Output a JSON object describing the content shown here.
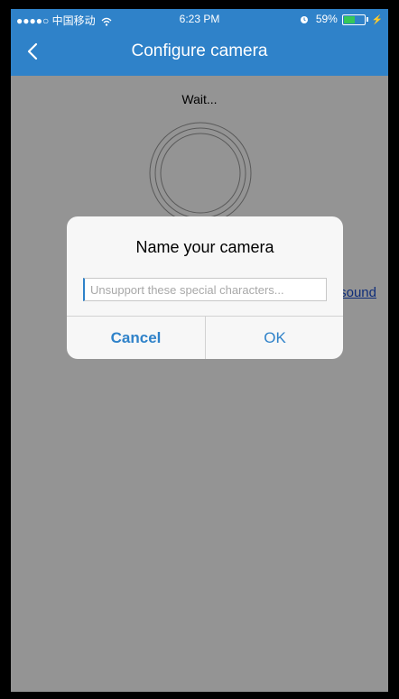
{
  "status_bar": {
    "carrier": "●●●●○ 中国移动",
    "wifi": "wifi-icon",
    "time": "6:23 PM",
    "alarm": "alarm-icon",
    "battery_text": "59%",
    "battery_level": 0.59,
    "charging": "⚡"
  },
  "nav": {
    "back_icon": "chevron-left-icon",
    "title": "Configure camera"
  },
  "content": {
    "wait_text": "Wait...",
    "link_text": "sound"
  },
  "dialog": {
    "title": "Name your camera",
    "input_value": "",
    "input_placeholder": "Unsupport these special characters...",
    "cancel_label": "Cancel",
    "ok_label": "OK"
  },
  "colors": {
    "nav_bg": "#2f82c9",
    "link": "#1a4fd0",
    "overlay": "rgba(0,0,0,0.42)"
  }
}
